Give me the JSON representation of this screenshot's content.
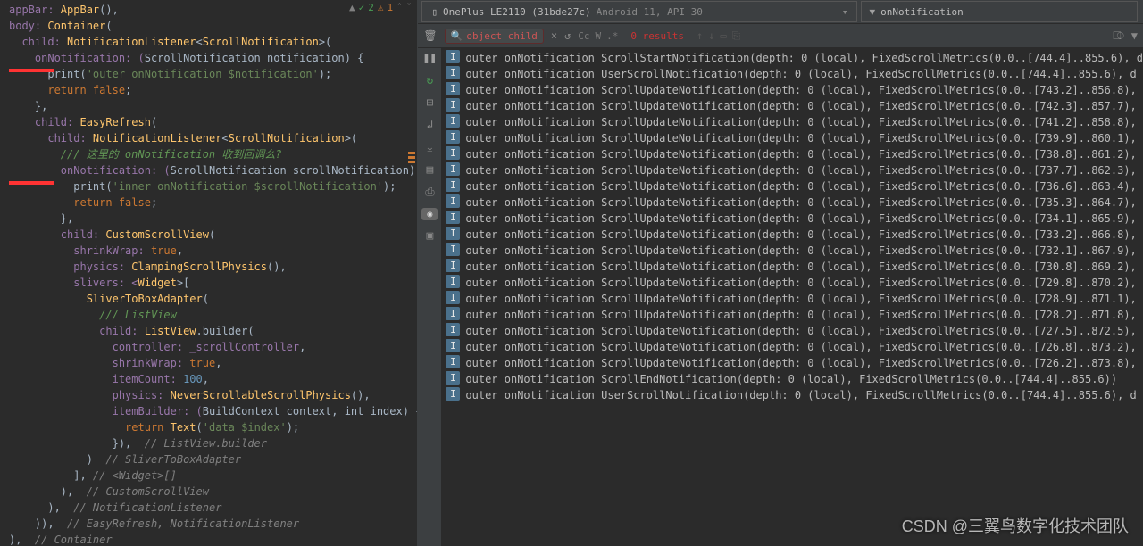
{
  "topIndicator": {
    "checkCount": "2",
    "warnCount": "1"
  },
  "code": [
    {
      "t": "appBar: ",
      "c": "field",
      "pre": ""
    },
    {
      "t": "AppBar",
      "c": "cls"
    },
    {
      "t": "(),",
      "c": "punct",
      "nl": true
    },
    {
      "t": "body: ",
      "c": "field",
      "pre": ""
    },
    {
      "t": "Container",
      "c": "cls"
    },
    {
      "t": "(",
      "c": "punct",
      "nl": true
    },
    {
      "t": "  child: ",
      "c": "field"
    },
    {
      "t": "NotificationListener",
      "c": "cls"
    },
    {
      "t": "<",
      "c": "punct"
    },
    {
      "t": "ScrollNotification",
      "c": "cls"
    },
    {
      "t": ">(",
      "c": "punct",
      "nl": true
    },
    {
      "t": "    onNotification: (",
      "c": "field"
    },
    {
      "t": "ScrollNotification notification",
      "c": "param"
    },
    {
      "t": ") {",
      "c": "punct",
      "nl": true
    },
    {
      "t": "      print(",
      "c": "punct"
    },
    {
      "t": "'outer onNotification $notification'",
      "c": "str"
    },
    {
      "t": ");",
      "c": "punct",
      "nl": true
    },
    {
      "t": "      ",
      "c": "punct"
    },
    {
      "t": "return false",
      "c": "kw"
    },
    {
      "t": ";",
      "c": "punct",
      "nl": true
    },
    {
      "t": "    },",
      "c": "punct",
      "nl": true
    },
    {
      "t": "    child: ",
      "c": "field"
    },
    {
      "t": "EasyRefresh",
      "c": "cls"
    },
    {
      "t": "(",
      "c": "punct",
      "nl": true
    },
    {
      "t": "      child: ",
      "c": "field"
    },
    {
      "t": "NotificationListener",
      "c": "cls"
    },
    {
      "t": "<",
      "c": "punct"
    },
    {
      "t": "ScrollNotification",
      "c": "cls"
    },
    {
      "t": ">(",
      "c": "punct",
      "nl": true
    },
    {
      "t": "        /// 这里的 onNotification 收到回调么?",
      "c": "cmt2",
      "nl": true
    },
    {
      "t": "        onNotification: (",
      "c": "field"
    },
    {
      "t": "ScrollNotification scrollNotification",
      "c": "param"
    },
    {
      "t": ") {",
      "c": "punct",
      "nl": true
    },
    {
      "t": "          print(",
      "c": "punct"
    },
    {
      "t": "'inner onNotification $scrollNotification'",
      "c": "str"
    },
    {
      "t": ");",
      "c": "punct",
      "nl": true
    },
    {
      "t": "          ",
      "c": "punct"
    },
    {
      "t": "return false",
      "c": "kw"
    },
    {
      "t": ";",
      "c": "punct",
      "nl": true
    },
    {
      "t": "        },",
      "c": "punct",
      "nl": true
    },
    {
      "t": "        child: ",
      "c": "field"
    },
    {
      "t": "CustomScrollView",
      "c": "cls"
    },
    {
      "t": "(",
      "c": "punct",
      "nl": true
    },
    {
      "t": "          shrinkWrap: ",
      "c": "field"
    },
    {
      "t": "true",
      "c": "true"
    },
    {
      "t": ",",
      "c": "punct",
      "nl": true
    },
    {
      "t": "          physics: ",
      "c": "field"
    },
    {
      "t": "ClampingScrollPhysics",
      "c": "cls"
    },
    {
      "t": "(),",
      "c": "punct",
      "nl": true
    },
    {
      "t": "          slivers: <",
      "c": "field"
    },
    {
      "t": "Widget",
      "c": "cls"
    },
    {
      "t": ">[",
      "c": "punct",
      "nl": true
    },
    {
      "t": "            ",
      "c": "punct"
    },
    {
      "t": "SliverToBoxAdapter",
      "c": "cls"
    },
    {
      "t": "(",
      "c": "punct",
      "nl": true
    },
    {
      "t": "              /// ListView",
      "c": "cmt2",
      "nl": true
    },
    {
      "t": "              child: ",
      "c": "field"
    },
    {
      "t": "ListView",
      "c": "cls"
    },
    {
      "t": ".builder(",
      "c": "punct",
      "nl": true
    },
    {
      "t": "                controller: ",
      "c": "field"
    },
    {
      "t": "_scrollController",
      "c": "field"
    },
    {
      "t": ",",
      "c": "punct",
      "nl": true
    },
    {
      "t": "                shrinkWrap: ",
      "c": "field"
    },
    {
      "t": "true",
      "c": "true"
    },
    {
      "t": ",",
      "c": "punct",
      "nl": true
    },
    {
      "t": "                itemCount: ",
      "c": "field"
    },
    {
      "t": "100",
      "c": "num"
    },
    {
      "t": ",",
      "c": "punct",
      "nl": true
    },
    {
      "t": "                physics: ",
      "c": "field"
    },
    {
      "t": "NeverScrollableScrollPhysics",
      "c": "cls"
    },
    {
      "t": "(),",
      "c": "punct",
      "nl": true
    },
    {
      "t": "                itemBuilder: (",
      "c": "field"
    },
    {
      "t": "BuildContext context",
      "c": "param"
    },
    {
      "t": ", ",
      "c": "punct"
    },
    {
      "t": "int index",
      "c": "param"
    },
    {
      "t": ") {",
      "c": "punct",
      "nl": true
    },
    {
      "t": "                  ",
      "c": "punct"
    },
    {
      "t": "return ",
      "c": "kw"
    },
    {
      "t": "Text",
      "c": "cls"
    },
    {
      "t": "(",
      "c": "punct"
    },
    {
      "t": "'data $index'",
      "c": "str"
    },
    {
      "t": ");",
      "c": "punct",
      "nl": true
    },
    {
      "t": "                }),  ",
      "c": "punct"
    },
    {
      "t": "// ListView.builder",
      "c": "cmt",
      "nl": true
    },
    {
      "t": "            )  ",
      "c": "punct"
    },
    {
      "t": "// SliverToBoxAdapter",
      "c": "cmt",
      "nl": true
    },
    {
      "t": "          ], ",
      "c": "punct"
    },
    {
      "t": "// <Widget>[]",
      "c": "cmt",
      "nl": true
    },
    {
      "t": "        ),  ",
      "c": "punct"
    },
    {
      "t": "// CustomScrollView",
      "c": "cmt",
      "nl": true
    },
    {
      "t": "      ),  ",
      "c": "punct"
    },
    {
      "t": "// NotificationListener",
      "c": "cmt",
      "nl": true
    },
    {
      "t": "    )),  ",
      "c": "punct"
    },
    {
      "t": "// EasyRefresh, NotificationListener",
      "c": "cmt",
      "nl": true
    },
    {
      "t": "),  ",
      "c": "punct"
    },
    {
      "t": "// Container",
      "c": "cmt",
      "nl": true
    }
  ],
  "device": {
    "name": "OnePlus LE2110 (31bde27c)",
    "detail": "Android 11, API 30"
  },
  "filter": "onNotification",
  "search": {
    "query": "object child",
    "results": "0 results",
    "opts": [
      "Cc",
      "W",
      ".*"
    ]
  },
  "logs": [
    "outer onNotification ScrollStartNotification(depth: 0 (local), FixedScrollMetrics(0.0..[744.4]..855.6), d",
    "outer onNotification UserScrollNotification(depth: 0 (local), FixedScrollMetrics(0.0..[744.4]..855.6), d",
    "outer onNotification ScrollUpdateNotification(depth: 0 (local), FixedScrollMetrics(0.0..[743.2]..856.8),",
    "outer onNotification ScrollUpdateNotification(depth: 0 (local), FixedScrollMetrics(0.0..[742.3]..857.7),",
    "outer onNotification ScrollUpdateNotification(depth: 0 (local), FixedScrollMetrics(0.0..[741.2]..858.8),",
    "outer onNotification ScrollUpdateNotification(depth: 0 (local), FixedScrollMetrics(0.0..[739.9]..860.1),",
    "outer onNotification ScrollUpdateNotification(depth: 0 (local), FixedScrollMetrics(0.0..[738.8]..861.2),",
    "outer onNotification ScrollUpdateNotification(depth: 0 (local), FixedScrollMetrics(0.0..[737.7]..862.3),",
    "outer onNotification ScrollUpdateNotification(depth: 0 (local), FixedScrollMetrics(0.0..[736.6]..863.4),",
    "outer onNotification ScrollUpdateNotification(depth: 0 (local), FixedScrollMetrics(0.0..[735.3]..864.7),",
    "outer onNotification ScrollUpdateNotification(depth: 0 (local), FixedScrollMetrics(0.0..[734.1]..865.9),",
    "outer onNotification ScrollUpdateNotification(depth: 0 (local), FixedScrollMetrics(0.0..[733.2]..866.8),",
    "outer onNotification ScrollUpdateNotification(depth: 0 (local), FixedScrollMetrics(0.0..[732.1]..867.9),",
    "outer onNotification ScrollUpdateNotification(depth: 0 (local), FixedScrollMetrics(0.0..[730.8]..869.2),",
    "outer onNotification ScrollUpdateNotification(depth: 0 (local), FixedScrollMetrics(0.0..[729.8]..870.2),",
    "outer onNotification ScrollUpdateNotification(depth: 0 (local), FixedScrollMetrics(0.0..[728.9]..871.1),",
    "outer onNotification ScrollUpdateNotification(depth: 0 (local), FixedScrollMetrics(0.0..[728.2]..871.8),",
    "outer onNotification ScrollUpdateNotification(depth: 0 (local), FixedScrollMetrics(0.0..[727.5]..872.5),",
    "outer onNotification ScrollUpdateNotification(depth: 0 (local), FixedScrollMetrics(0.0..[726.8]..873.2),",
    "outer onNotification ScrollUpdateNotification(depth: 0 (local), FixedScrollMetrics(0.0..[726.2]..873.8),",
    "outer onNotification ScrollEndNotification(depth: 0 (local), FixedScrollMetrics(0.0..[744.4]..855.6))",
    "outer onNotification UserScrollNotification(depth: 0 (local), FixedScrollMetrics(0.0..[744.4]..855.6), d"
  ],
  "watermark": "CSDN @三翼鸟数字化技术团队"
}
